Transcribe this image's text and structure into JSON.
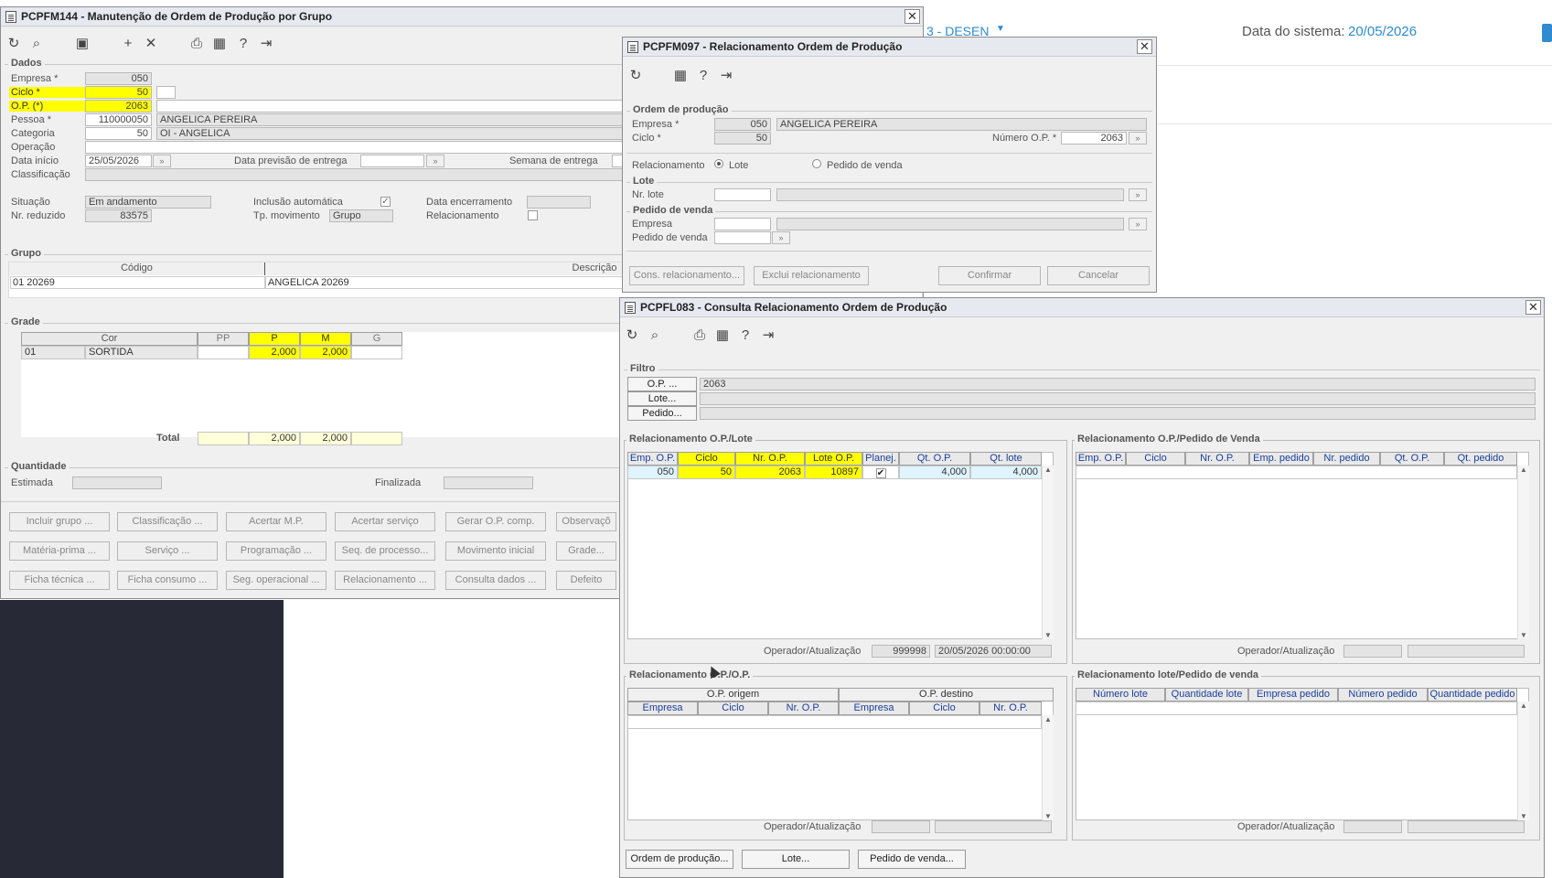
{
  "background": {
    "env_label": "3 - DESEN",
    "system_date_label": "Data do sistema:",
    "system_date_value": "20/05/2026",
    "accent": "#2e8bcf"
  },
  "win1": {
    "title": "PCPFM144 - Manutenção de Ordem de Produção por Grupo",
    "toolbar": [
      "refresh-icon",
      "search-icon",
      "save-icon",
      "add-icon",
      "delete-icon",
      "print-icon",
      "calendar-icon",
      "help-icon",
      "exit-icon"
    ],
    "dados": {
      "title": "Dados",
      "empresa_label": "Empresa *",
      "empresa": "050",
      "ciclo_label": "Ciclo *",
      "ciclo": "50",
      "op_label": "O.P. (*)",
      "op": "2063",
      "pessoa_label": "Pessoa *",
      "pessoa_cod": "110000050",
      "pessoa_nome": "ANGELICA PEREIRA",
      "categoria_label": "Categoria",
      "categoria_cod": "50",
      "categoria_nome": "OI - ANGELICA",
      "operacao_label": "Operação",
      "data_inicio_label": "Data início",
      "data_inicio": "25/05/2026",
      "data_previsao_label": "Data previsão de entrega",
      "semana_label": "Semana de entrega",
      "classificacao_label": "Classificação",
      "situacao_label": "Situação",
      "situacao": "Em andamento",
      "nr_reduzido_label": "Nr. reduzido",
      "nr_reduzido": "83575",
      "inclusao_label": "Inclusão automática",
      "tp_mov_label": "Tp. movimento",
      "tp_mov": "Grupo",
      "data_enc_label": "Data encerramento",
      "relacionamento_label": "Relacionamento"
    },
    "grupo": {
      "title": "Grupo",
      "col_codigo": "Código",
      "col_descricao": "Descrição",
      "codigo": "01 20269",
      "descricao": "ANGELICA 20269"
    },
    "grade": {
      "title": "Grade",
      "headers": [
        "Cor",
        "PP",
        "P",
        "M",
        "G"
      ],
      "row": {
        "cod": "01",
        "cor": "SORTIDA",
        "pp": "",
        "p": "2,000",
        "m": "2,000",
        "g": ""
      },
      "total_label": "Total",
      "total": {
        "pp": "",
        "p": "2,000",
        "m": "2,000",
        "g": ""
      }
    },
    "quantidade": {
      "title": "Quantidade",
      "estimada_label": "Estimada",
      "finalizada_label": "Finalizada"
    },
    "buttons": [
      [
        "Incluir grupo ...",
        "Classificação ...",
        "Acertar M.P.",
        "Acertar serviço",
        "Gerar O.P. comp.",
        "Observaçõ"
      ],
      [
        "Matéria-prima ...",
        "Serviço ...",
        "Programação ...",
        "Seq. de processo...",
        "Movimento inicial",
        "Grade..."
      ],
      [
        "Ficha técnica ...",
        "Ficha consumo ...",
        "Seg. operacional ...",
        "Relacionamento ...",
        "Consulta dados ...",
        "Defeito"
      ]
    ]
  },
  "win2": {
    "title": "PCPFM097 - Relacionamento Ordem de Produção",
    "toolbar": [
      "refresh-icon",
      "calendar-icon",
      "help-icon",
      "exit-icon"
    ],
    "op": {
      "title": "Ordem de produção",
      "empresa_label": "Empresa *",
      "empresa": "050",
      "empresa_nome": "ANGELICA PEREIRA",
      "ciclo_label": "Ciclo *",
      "ciclo": "50",
      "numero_label": "Número O.P. *",
      "numero": "2063"
    },
    "relacionamento_label": "Relacionamento",
    "radio_lote": "Lote",
    "radio_pedido": "Pedido de venda",
    "lote": {
      "title": "Lote",
      "nr_lote_label": "Nr. lote"
    },
    "pedido": {
      "title": "Pedido de venda",
      "empresa_label": "Empresa",
      "pedido_label": "Pedido de venda"
    },
    "buttons": {
      "cons": "Cons. relacionamento...",
      "exclui": "Exclui relacionamento",
      "confirmar": "Confirmar",
      "cancelar": "Cancelar"
    }
  },
  "win3": {
    "title": "PCPFL083 - Consulta Relacionamento Ordem de Produção",
    "toolbar": [
      "refresh-icon",
      "search-icon",
      "print-icon",
      "calendar-icon",
      "help-icon",
      "exit-icon"
    ],
    "filtro": {
      "title": "Filtro",
      "op_btn": "O.P. ...",
      "op_value": "2063",
      "lote_btn": "Lote...",
      "pedido_btn": "Pedido..."
    },
    "op_lote": {
      "title": "Relacionamento O.P./Lote",
      "headers": [
        "Emp. O.P.",
        "Ciclo",
        "Nr. O.P.",
        "Lote O.P.",
        "Planej.",
        "Qt. O.P.",
        "Qt. lote"
      ],
      "row": {
        "emp": "050",
        "ciclo": "50",
        "nr_op": "2063",
        "lote_op": "10897",
        "planej": "✔",
        "qt_op": "4,000",
        "qt_lote": "4,000"
      },
      "operador_label": "Operador/Atualização",
      "operador": "999998",
      "atualizacao": "20/05/2026 00:00:00"
    },
    "op_pedido": {
      "title": "Relacionamento O.P./Pedido de Venda",
      "headers": [
        "Emp. O.P.",
        "Ciclo",
        "Nr. O.P.",
        "Emp. pedido",
        "Nr. pedido",
        "Qt. O.P.",
        "Qt. pedido"
      ],
      "operador_label": "Operador/Atualização"
    },
    "op_op": {
      "title": "Relacionamento O.P./O.P.",
      "origem": "O.P. origem",
      "destino": "O.P. destino",
      "headers": [
        "Empresa",
        "Ciclo",
        "Nr. O.P.",
        "Empresa",
        "Ciclo",
        "Nr. O.P."
      ],
      "operador_label": "Operador/Atualização"
    },
    "lote_pedido": {
      "title": "Relacionamento lote/Pedido de venda",
      "headers": [
        "Número lote",
        "Quantidade lote",
        "Empresa pedido",
        "Número pedido",
        "Quantidade pedido"
      ],
      "operador_label": "Operador/Atualização"
    },
    "buttons": {
      "ordem": "Ordem de produção...",
      "lote": "Lote...",
      "pedido": "Pedido de venda..."
    }
  }
}
